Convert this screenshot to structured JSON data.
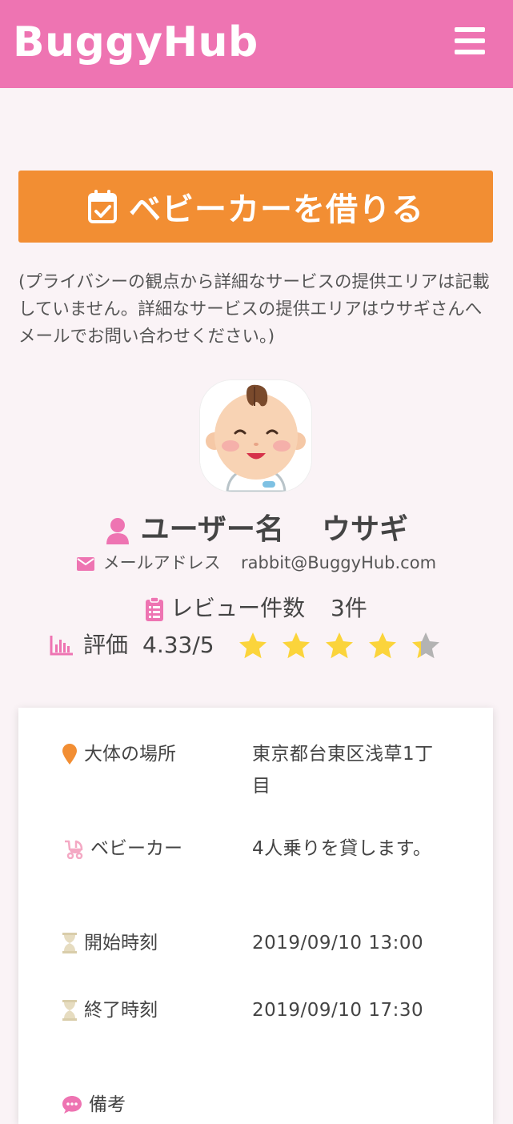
{
  "header": {
    "brand": "BuggyHub",
    "menu_icon": "hamburger-menu-icon"
  },
  "rent_button": {
    "label": "ベビーカーを借りる",
    "icon": "calendar-check-icon"
  },
  "privacy_note": "(プライバシーの観点から詳細なサービスの提供エリアは記載していません。詳細なサービスの提供エリアはウサギさんへメールでお問い合わせください。)",
  "profile": {
    "username_label": "ユーザー名",
    "username": "ウサギ",
    "email_label": "メールアドレス",
    "email": "rabbit@BuggyHub.com",
    "reviews_label": "レビュー件数",
    "reviews_count": "3件",
    "rating_label": "評価",
    "rating_value": "4.33/5",
    "rating": 4.33,
    "rating_max": 5
  },
  "details": {
    "location_label": "大体の場所",
    "location_value": "東京都台東区浅草1丁目",
    "buggy_label": "ベビーカー",
    "buggy_value": "4人乗りを貸します。",
    "start_label": "開始時刻",
    "start_value": "2019/09/10 13:00",
    "end_label": "終了時刻",
    "end_value": "2019/09/10 17:30",
    "notes_label": "備考"
  },
  "colors": {
    "header": "#ee74b2",
    "accent_button": "#f28e33",
    "icon_pink": "#ee74b2",
    "star": "#fbd43b",
    "star_empty": "#b3b3b3",
    "pin": "#f28e33",
    "hourglass": "#d9cdaa"
  }
}
